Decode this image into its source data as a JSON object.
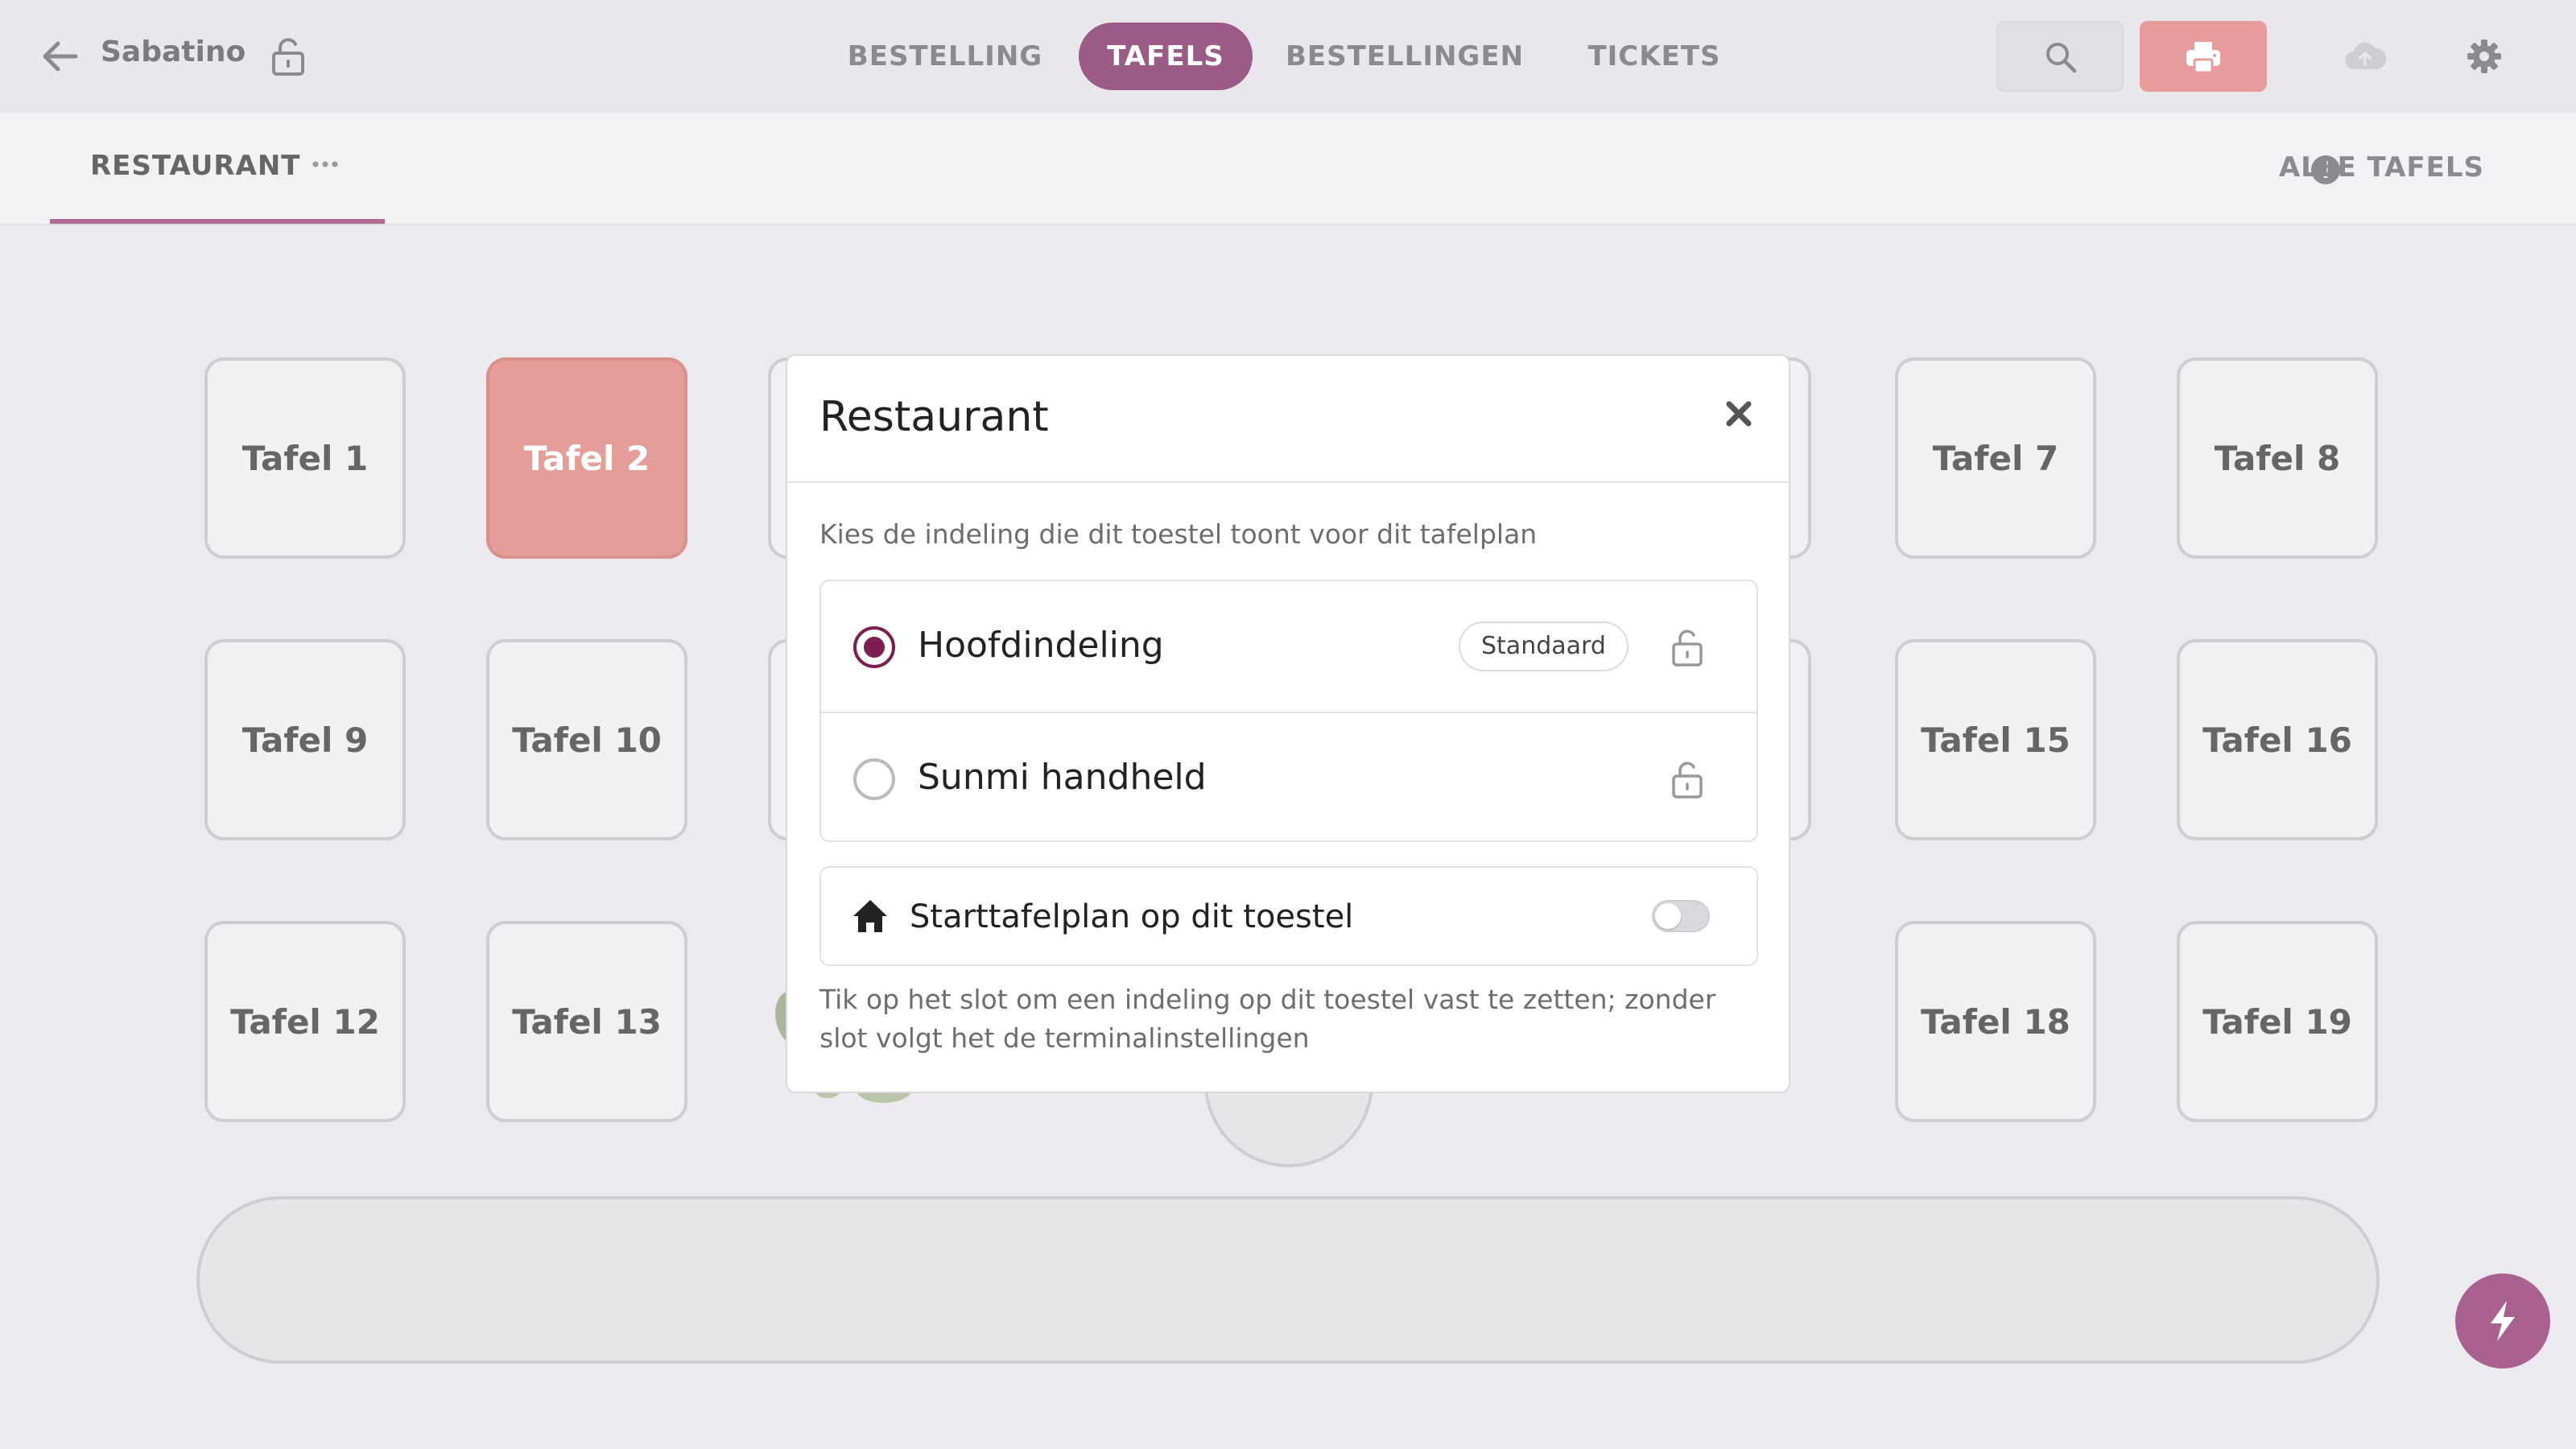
{
  "header": {
    "venue": "Sabatino",
    "tabs": [
      {
        "label": "BESTELLING"
      },
      {
        "label": "TAFELS"
      },
      {
        "label": "BESTELLINGEN"
      },
      {
        "label": "TICKETS"
      }
    ],
    "active_tab": "TAFELS"
  },
  "subbar": {
    "section_tab": "RESTAURANT",
    "all_tables_label": "ALLE TAFELS"
  },
  "floor": {
    "tables": [
      {
        "label": "Tafel 1",
        "status": "free"
      },
      {
        "label": "Tafel 2",
        "status": "occupied"
      },
      {
        "label": "Tafel 7",
        "status": "free"
      },
      {
        "label": "Tafel 8",
        "status": "free"
      },
      {
        "label": "Tafel 9",
        "status": "free"
      },
      {
        "label": "Tafel 10",
        "status": "free"
      },
      {
        "label": "Tafel 15",
        "status": "free"
      },
      {
        "label": "Tafel 16",
        "status": "free"
      },
      {
        "label": "Tafel 12",
        "status": "free"
      },
      {
        "label": "Tafel 13",
        "status": "free"
      },
      {
        "label": "Tafel 18",
        "status": "free"
      },
      {
        "label": "Tafel 19",
        "status": "free"
      }
    ]
  },
  "modal": {
    "title": "Restaurant",
    "description": "Kies de indeling die dit toestel toont voor dit tafelplan",
    "options": [
      {
        "label": "Hoofdindeling",
        "badge": "Standaard",
        "selected": true,
        "locked": false
      },
      {
        "label": "Sunmi handheld",
        "badge": "",
        "selected": false,
        "locked": false
      }
    ],
    "start_plan_label": "Starttafelplan op dit toestel",
    "start_plan_enabled": false,
    "footnote": "Tik op het slot om een indeling op dit toestel vast te zetten; zonder slot volgt het de terminalinstellingen"
  },
  "colors": {
    "accent": "#9a5b86",
    "radio_selected": "#7a1f4f",
    "occupied_table": "#e59d97",
    "print_button": "#e79b9b"
  }
}
